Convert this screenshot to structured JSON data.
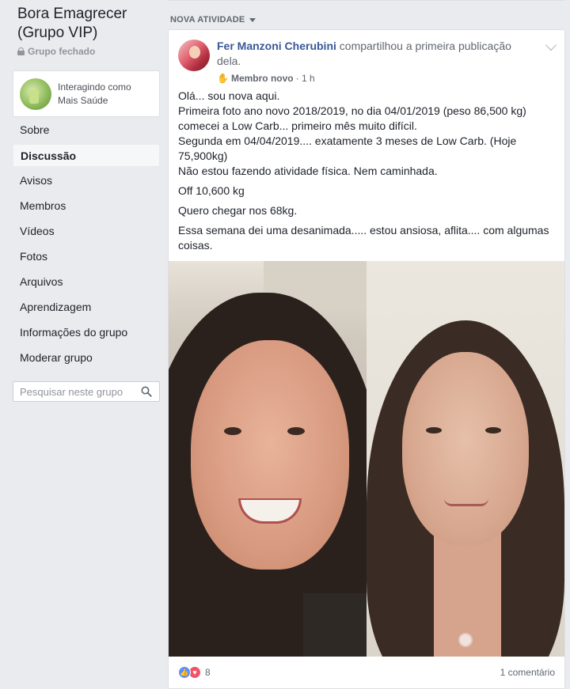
{
  "group": {
    "name": "Bora Emagrecer (Grupo VIP)",
    "type": "Grupo fechado"
  },
  "interacting": {
    "label": "Interagindo como Mais Saúde"
  },
  "nav": {
    "items": [
      {
        "label": "Sobre"
      },
      {
        "label": "Discussão"
      },
      {
        "label": "Avisos"
      },
      {
        "label": "Membros"
      },
      {
        "label": "Vídeos"
      },
      {
        "label": "Fotos"
      },
      {
        "label": "Arquivos"
      },
      {
        "label": "Aprendizagem"
      },
      {
        "label": "Informações do grupo"
      },
      {
        "label": "Moderar grupo"
      }
    ],
    "active": "Discussão"
  },
  "search": {
    "placeholder": "Pesquisar neste grupo"
  },
  "feed": {
    "header": "NOVA ATIVIDADE"
  },
  "post": {
    "author": "Fer Manzoni Cherubini",
    "action": "compartilhou a primeira publicação dela.",
    "badge": "Membro novo",
    "time": "· 1 h",
    "body": [
      "Olá... sou nova aqui.\nPrimeira foto ano novo 2018/2019, no dia 04/01/2019 (peso 86,500 kg) comecei a Low Carb... primeiro mês muito difícil.\nSegunda em 04/04/2019.... exatamente 3 meses de Low Carb. (Hoje 75,900kg)\nNão estou fazendo atividade física. Nem caminhada.",
      "Off 10,600 kg",
      "Quero chegar nos 68kg.",
      "Essa semana dei uma desanimada..... estou ansiosa, aflita.... com algumas coisas."
    ],
    "reactions_count": "8",
    "comments": "1 comentário"
  },
  "icons": {
    "lock": "lock-icon",
    "search": "search-icon",
    "caret": "caret-down-icon",
    "wave": "wave-icon",
    "like": "like-icon",
    "love": "love-icon",
    "chevron": "chevron-down-icon"
  },
  "colors": {
    "background": "#e9ebee",
    "link": "#385898",
    "like": "#5890ff",
    "love": "#f25268"
  }
}
